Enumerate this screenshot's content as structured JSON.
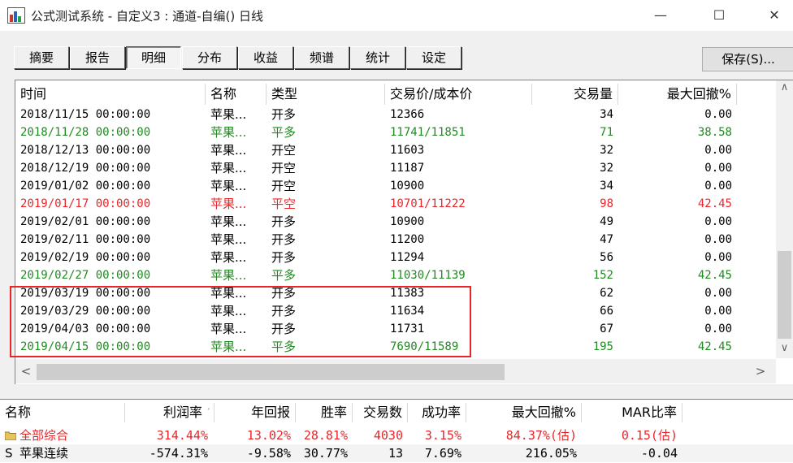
{
  "window": {
    "title": "公式测试系统 - 自定义3 : 通道-自编() 日线",
    "minimize": "—",
    "maximize": "☐",
    "close": "✕"
  },
  "tabs": [
    "摘要",
    "报告",
    "明细",
    "分布",
    "收益",
    "频谱",
    "统计",
    "设定"
  ],
  "active_tab": "明细",
  "save_button": "保存(S)...",
  "trades": {
    "columns": [
      "时间",
      "名称",
      "类型",
      "交易价/成本价",
      "交易量",
      "最大回撤%"
    ],
    "rows": [
      {
        "time": "2018/11/15 00:00:00",
        "name": "苹果...",
        "type": "开多",
        "price": "12366",
        "qty": "34",
        "dd": "0.00",
        "style": "normal"
      },
      {
        "time": "2018/11/28 00:00:00",
        "name": "苹果...",
        "type": "平多",
        "price": "11741/11851",
        "qty": "71",
        "dd": "38.58",
        "style": "green"
      },
      {
        "time": "2018/12/13 00:00:00",
        "name": "苹果...",
        "type": "开空",
        "price": "11603",
        "qty": "32",
        "dd": "0.00",
        "style": "normal"
      },
      {
        "time": "2018/12/19 00:00:00",
        "name": "苹果...",
        "type": "开空",
        "price": "11187",
        "qty": "32",
        "dd": "0.00",
        "style": "normal"
      },
      {
        "time": "2019/01/02 00:00:00",
        "name": "苹果...",
        "type": "开空",
        "price": "10900",
        "qty": "34",
        "dd": "0.00",
        "style": "normal"
      },
      {
        "time": "2019/01/17 00:00:00",
        "name": "苹果...",
        "type": "平空",
        "price": "10701/11222",
        "qty": "98",
        "dd": "42.45",
        "style": "red"
      },
      {
        "time": "2019/02/01 00:00:00",
        "name": "苹果...",
        "type": "开多",
        "price": "10900",
        "qty": "49",
        "dd": "0.00",
        "style": "normal"
      },
      {
        "time": "2019/02/11 00:00:00",
        "name": "苹果...",
        "type": "开多",
        "price": "11200",
        "qty": "47",
        "dd": "0.00",
        "style": "normal"
      },
      {
        "time": "2019/02/19 00:00:00",
        "name": "苹果...",
        "type": "开多",
        "price": "11294",
        "qty": "56",
        "dd": "0.00",
        "style": "normal"
      },
      {
        "time": "2019/02/27 00:00:00",
        "name": "苹果...",
        "type": "平多",
        "price": "11030/11139",
        "qty": "152",
        "dd": "42.45",
        "style": "green"
      },
      {
        "time": "2019/03/19 00:00:00",
        "name": "苹果...",
        "type": "开多",
        "price": "11383",
        "qty": "62",
        "dd": "0.00",
        "style": "normal"
      },
      {
        "time": "2019/03/29 00:00:00",
        "name": "苹果...",
        "type": "开多",
        "price": "11634",
        "qty": "66",
        "dd": "0.00",
        "style": "normal"
      },
      {
        "time": "2019/04/03 00:00:00",
        "name": "苹果...",
        "type": "开多",
        "price": "11731",
        "qty": "67",
        "dd": "0.00",
        "style": "normal"
      },
      {
        "time": "2019/04/15 00:00:00",
        "name": "苹果...",
        "type": "平多",
        "price": "7690/11589",
        "qty": "195",
        "dd": "42.45",
        "style": "green"
      }
    ]
  },
  "summary": {
    "columns": [
      "名称",
      "利润率",
      "年回报",
      "胜率",
      "交易数",
      "成功率",
      "最大回撤%",
      "MAR比率"
    ],
    "sort_indicator": "ˊ",
    "rows": [
      {
        "icon": "folder-icon",
        "name": "全部综合",
        "profit": "314.44%",
        "annual": "13.02%",
        "win": "28.81%",
        "trades": "4030",
        "success": "3.15%",
        "dd": "84.37%(估)",
        "mar": "0.15(估)",
        "style": "red"
      },
      {
        "icon": "s-marker",
        "marker": "S",
        "name": "苹果连续",
        "profit": "-574.31%",
        "annual": "-9.58%",
        "win": "30.77%",
        "trades": "13",
        "success": "7.69%",
        "dd": "216.05%",
        "mar": "-0.04",
        "style": "normal"
      }
    ]
  },
  "colors": {
    "green": "#1f8a1f",
    "red": "#e8262a",
    "highlight_box": "#e8262a"
  },
  "scroll_arrows": {
    "up": "∧",
    "down": "∨",
    "left": "<",
    "right": ">"
  }
}
